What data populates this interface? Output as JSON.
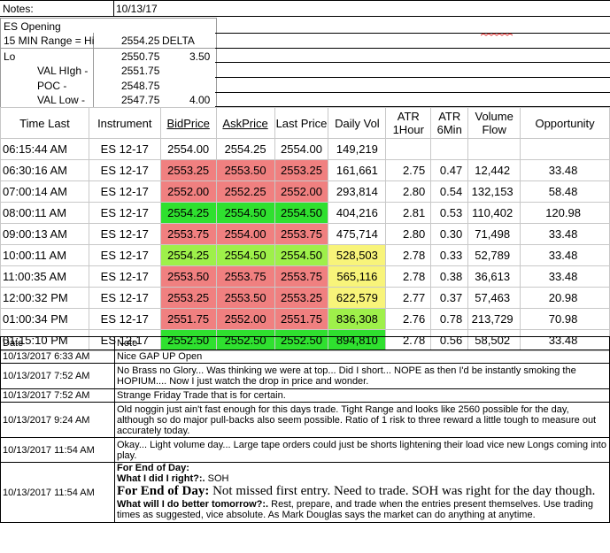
{
  "notes": {
    "title_label": "Notes:",
    "date_value": "10/13/17",
    "rows": [
      {
        "label": "ES Opening",
        "value": "",
        "extra": ""
      },
      {
        "label": "15 MIN Range = Hi",
        "value": "2554.25",
        "extra": "DELTA"
      },
      {
        "label": "Lo",
        "value": "2550.75",
        "extra": "3.50"
      },
      {
        "label": "VAL HIgh  -",
        "value": "2551.75",
        "extra": ""
      },
      {
        "label": "POC  -",
        "value": "2548.75",
        "extra": ""
      },
      {
        "label": "VAL Low  -",
        "value": "2547.75",
        "extra": "4.00"
      }
    ]
  },
  "trade_table": {
    "headers": [
      "Time Last",
      "Instrument",
      "BidPrice",
      "AskPrice",
      "Last Price",
      "Daily Vol",
      "ATR 1Hour",
      "ATR 6Min",
      "Volume Flow",
      "Opportunity"
    ],
    "rows": [
      {
        "time": "06:15:44 AM",
        "inst": "ES 12-17",
        "bid": "2554.00",
        "ask": "2554.25",
        "last": "2554.00",
        "vol": "149,219",
        "atr1": "",
        "atr6": "",
        "flow": "",
        "opp": "",
        "price_color": "none",
        "vol_color": "none"
      },
      {
        "time": "06:30:16 AM",
        "inst": "ES 12-17",
        "bid": "2553.25",
        "ask": "2553.50",
        "last": "2553.25",
        "vol": "161,661",
        "atr1": "2.75",
        "atr6": "0.47",
        "flow": "12,442",
        "opp": "33.48",
        "price_color": "pink",
        "vol_color": "none"
      },
      {
        "time": "07:00:14 AM",
        "inst": "ES 12-17",
        "bid": "2552.00",
        "ask": "2552.25",
        "last": "2552.00",
        "vol": "293,814",
        "atr1": "2.80",
        "atr6": "0.54",
        "flow": "132,153",
        "opp": "58.48",
        "price_color": "pink",
        "vol_color": "none"
      },
      {
        "time": "08:00:11 AM",
        "inst": "ES 12-17",
        "bid": "2554.25",
        "ask": "2554.50",
        "last": "2554.50",
        "vol": "404,216",
        "atr1": "2.81",
        "atr6": "0.53",
        "flow": "110,402",
        "opp": "120.98",
        "price_color": "green",
        "vol_color": "none"
      },
      {
        "time": "09:00:13 AM",
        "inst": "ES 12-17",
        "bid": "2553.75",
        "ask": "2554.00",
        "last": "2553.75",
        "vol": "475,714",
        "atr1": "2.80",
        "atr6": "0.30",
        "flow": "71,498",
        "opp": "33.48",
        "price_color": "pink",
        "vol_color": "none"
      },
      {
        "time": "10:00:11 AM",
        "inst": "ES 12-17",
        "bid": "2554.25",
        "ask": "2554.50",
        "last": "2554.50",
        "vol": "528,503",
        "atr1": "2.78",
        "atr6": "0.33",
        "flow": "52,789",
        "opp": "33.48",
        "price_color": "lime",
        "vol_color": "yellow"
      },
      {
        "time": "11:00:35 AM",
        "inst": "ES 12-17",
        "bid": "2553.50",
        "ask": "2553.75",
        "last": "2553.75",
        "vol": "565,116",
        "atr1": "2.78",
        "atr6": "0.38",
        "flow": "36,613",
        "opp": "33.48",
        "price_color": "pink",
        "vol_color": "yellow"
      },
      {
        "time": "12:00:32 PM",
        "inst": "ES 12-17",
        "bid": "2553.25",
        "ask": "2553.50",
        "last": "2553.25",
        "vol": "622,579",
        "atr1": "2.77",
        "atr6": "0.37",
        "flow": "57,463",
        "opp": "20.98",
        "price_color": "pink",
        "vol_color": "yellow"
      },
      {
        "time": "01:00:34 PM",
        "inst": "ES 12-17",
        "bid": "2551.75",
        "ask": "2552.00",
        "last": "2551.75",
        "vol": "836,308",
        "atr1": "2.76",
        "atr6": "0.78",
        "flow": "213,729",
        "opp": "70.98",
        "price_color": "pink",
        "vol_color": "lime"
      },
      {
        "time": "01:15:10 PM",
        "inst": "ES 12-17",
        "bid": "2552.50",
        "ask": "2552.50",
        "last": "2552.50",
        "vol": "894,810",
        "atr1": "2.78",
        "atr6": "0.56",
        "flow": "58,502",
        "opp": "33.48",
        "price_color": "green",
        "vol_color": "green"
      }
    ]
  },
  "journal": {
    "header_date": "Date",
    "header_note": "Note",
    "entries": [
      {
        "date": "10/13/2017 6:33 AM",
        "note": "Nice GAP UP Open"
      },
      {
        "date": "10/13/2017 7:52 AM",
        "note": "No Brass no Glory... Was thinking we were at top... Did I short... NOPE as then I'd be instantly smoking the HOPIUM.... Now I just watch the drop in price and wonder."
      },
      {
        "date": "10/13/2017 7:52 AM",
        "note": "Strange Friday Trade that is for certain."
      },
      {
        "date": "10/13/2017 9:24 AM",
        "note": "Old noggin just ain't fast enough for this days trade.  Tight Range and looks like 2560 possible for the day, although so do major pull-backs also seem possible.  Ratio of 1 risk to three reward a little tough to measure out accurately today."
      },
      {
        "date": "10/13/2017 11:54 AM",
        "note": "Okay... Light volume day... Large tape orders could just be shorts lightening their load vice new Longs coming into play."
      }
    ],
    "final_entry": {
      "date": "10/13/2017 11:54 AM",
      "line1": "For End of Day:",
      "line2_bold": "What I did I right?:.",
      "line2_rest": "  SOH",
      "line3_bold": "For End of Day:",
      "line3_rest": "  Not missed first entry.  Need to trade.  SOH was right for the day though.",
      "line4_bold": "What will I do better tomorrow?:.",
      "line4_rest": "  Rest, prepare, and trade when the entries present themselves.  Use trading times as suggested, vice absolute.  As Mark Douglas says the market can do anything at anytime."
    }
  },
  "colors": {
    "pink": "#f08080",
    "green": "#2fe02f",
    "lime": "#9ef04a",
    "yellow": "#f8f47a"
  }
}
